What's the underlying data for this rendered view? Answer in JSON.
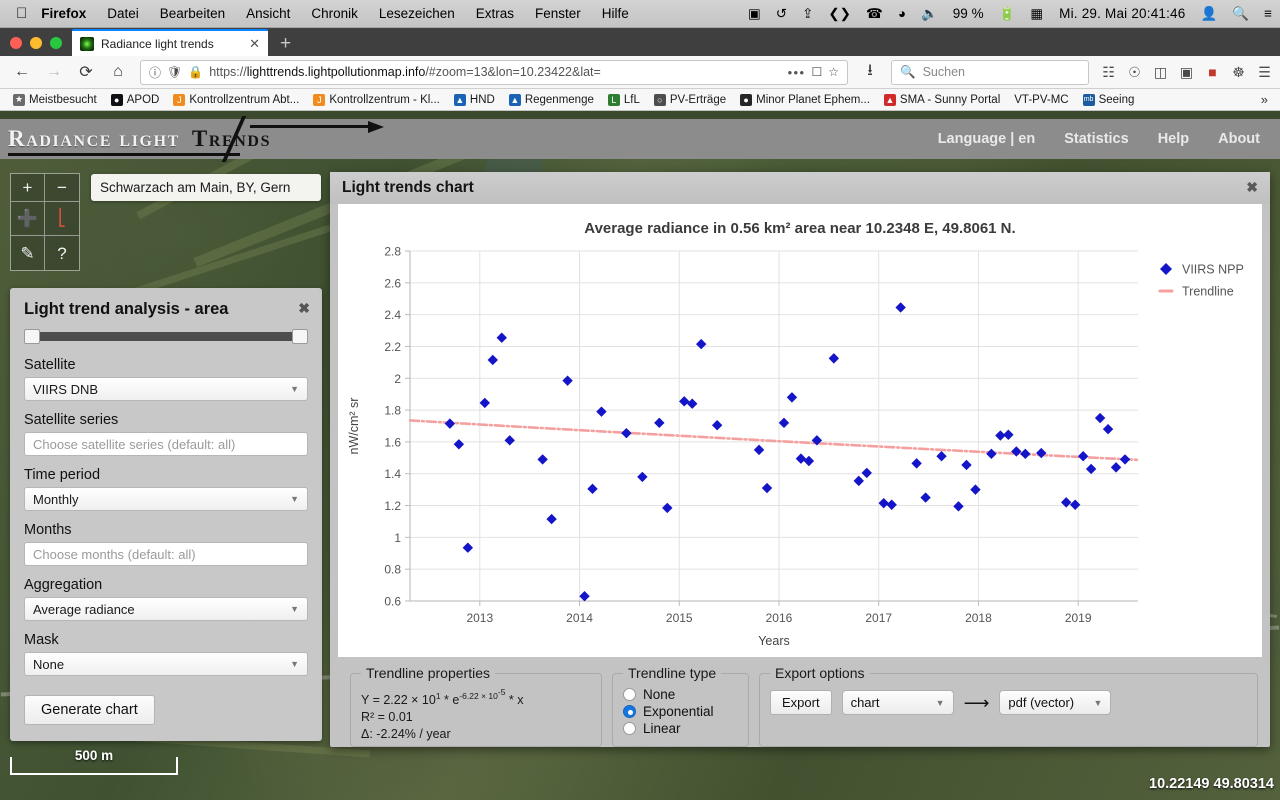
{
  "os_menubar": {
    "apple_icon": "apple-icon",
    "app_name": "Firefox",
    "menus": [
      "Datei",
      "Bearbeiten",
      "Ansicht",
      "Chronik",
      "Lesezeichen",
      "Extras",
      "Fenster",
      "Hilfe"
    ],
    "status_icons": [
      "dropbox-icon",
      "timemachine-icon",
      "bluetooth-icon",
      "code-icon",
      "phone-icon",
      "wifi-icon",
      "volume-icon"
    ],
    "battery_percent": "99 %",
    "battery_icon": "battery-charging-icon",
    "keyboard_icon": "keyboard-input-icon",
    "clock": "Mi. 29. Mai  20:41:46",
    "user_icon": "user-icon",
    "spotlight_icon": "search-icon",
    "notification_icon": "notification-center-icon"
  },
  "browser": {
    "tab": {
      "title": "Radiance light trends",
      "favicon": "globe-nightlights-favicon",
      "close_label": "✕"
    },
    "newtab_label": "+",
    "nav": {
      "back": "←",
      "forward": "→",
      "reload": "⟳",
      "home": "⌂"
    },
    "urlbar": {
      "info_icon": "page-info-icon",
      "shield_icon": "tracking-protection-icon",
      "lock_icon": "lock-icon",
      "url_scheme": "https://",
      "url_host": "lighttrends.lightpollutionmap.info",
      "url_path": "/#zoom=13&lon=10.23422&lat=",
      "overflow_dots": "•••",
      "reader_icon": "reader-mode-icon",
      "bookmark_star": "☆"
    },
    "downloads_icon": "download-icon",
    "search": {
      "icon": "search-icon",
      "placeholder": "Suchen",
      "value": ""
    },
    "chrome_icons": [
      "library-icon",
      "pocket-icon",
      "sidebar-icon",
      "container-icon",
      "adobe-pdf-icon",
      "sync-icon"
    ],
    "menu_icon": "hamburger-menu-icon",
    "bookmarks": [
      {
        "label": "Meistbesucht",
        "icon": "star-folder-icon",
        "color": "#6b6b6b"
      },
      {
        "label": "APOD",
        "icon": "apod-icon",
        "color": "#101014"
      },
      {
        "label": "Kontrollzentrum Abt...",
        "icon": "joomla-icon",
        "color": "#f28b1d"
      },
      {
        "label": "Kontrollzentrum - Kl...",
        "icon": "joomla-icon",
        "color": "#f28b1d"
      },
      {
        "label": "HND",
        "icon": "hnd-icon",
        "color": "#1b63b5"
      },
      {
        "label": "Regenmenge",
        "icon": "rain-icon",
        "color": "#1b63b5"
      },
      {
        "label": "LfL",
        "icon": "lfl-icon",
        "color": "#2f7d32"
      },
      {
        "label": "PV-Erträge",
        "icon": "globe-icon",
        "color": "#4d4d4d"
      },
      {
        "label": "Minor Planet Ephem...",
        "icon": "planet-icon",
        "color": "#262626"
      },
      {
        "label": "SMA - Sunny Portal",
        "icon": "sma-icon",
        "color": "#d02a2a"
      },
      {
        "label": "VT-PV-MC",
        "icon": "blank-page-icon",
        "color": "#00000000"
      },
      {
        "label": "Seeing",
        "icon": "meteoblue-icon",
        "color": "#1d5c9e"
      }
    ],
    "bookmarks_overflow": "»"
  },
  "site": {
    "logo_part1": "Radiance light",
    "logo_part2": "Trends",
    "nav": [
      "Language | en",
      "Statistics",
      "Help",
      "About"
    ]
  },
  "map": {
    "controls": [
      {
        "name": "zoom-in",
        "glyph": "+"
      },
      {
        "name": "zoom-out",
        "glyph": "−"
      },
      {
        "name": "crosshair-select",
        "glyph": "➕"
      },
      {
        "name": "draw-area",
        "glyph": "⟀"
      },
      {
        "name": "measure-ruler",
        "glyph": "✐"
      },
      {
        "name": "help",
        "glyph": "?"
      }
    ],
    "place_label": "Schwarzach am Main, BY, Gern",
    "scale_label": "500 m",
    "coordinates": "10.22149 49.80314"
  },
  "analysis_panel": {
    "title": "Light trend analysis - area",
    "close_label": "✖",
    "fields": [
      {
        "label": "Satellite",
        "type": "select",
        "value": "VIIRS DNB"
      },
      {
        "label": "Satellite series",
        "type": "input",
        "value": "",
        "placeholder": "Choose satellite series (default: all)"
      },
      {
        "label": "Time period",
        "type": "select",
        "value": "Monthly"
      },
      {
        "label": "Months",
        "type": "input",
        "value": "",
        "placeholder": "Choose months (default: all)"
      },
      {
        "label": "Aggregation",
        "type": "select",
        "value": "Average radiance"
      },
      {
        "label": "Mask",
        "type": "select",
        "value": "None"
      }
    ],
    "generate_button": "Generate chart"
  },
  "chart_window": {
    "title": "Light trends chart",
    "close_label": "✖"
  },
  "chart_data": {
    "type": "scatter",
    "title": "Average radiance in 0.56 km² area near 10.2348 E, 49.8061 N.",
    "xlabel": "Years",
    "ylabel": "nW/cm² sr",
    "xlim": [
      2012.3,
      2019.6
    ],
    "ylim": [
      0.6,
      2.8
    ],
    "ytick_step": 0.2,
    "yticks": [
      0.6,
      0.8,
      1.0,
      1.2,
      1.4,
      1.6,
      1.8,
      2.0,
      2.2,
      2.4,
      2.6,
      2.8
    ],
    "ytick_labels": [
      "0.6",
      "0.8",
      "1",
      "1.2",
      "1.4",
      "1.6",
      "1.8",
      "2",
      "2.2",
      "2.4",
      "2.6",
      "2.8"
    ],
    "xticks": [
      2013,
      2014,
      2015,
      2016,
      2017,
      2018,
      2019
    ],
    "xtick_labels": [
      "2013",
      "2014",
      "2015",
      "2016",
      "2017",
      "2018",
      "2019"
    ],
    "grid": true,
    "legend_position": "right",
    "legend": [
      {
        "label": "VIIRS NPP",
        "marker": "diamond",
        "color": "#1414c8"
      },
      {
        "label": "Trendline",
        "marker": "line-dashed",
        "color": "#f4a0a0"
      }
    ],
    "series": [
      {
        "name": "VIIRS NPP",
        "color": "#1414c8",
        "marker": "diamond",
        "points": [
          [
            2012.7,
            1.715
          ],
          [
            2012.79,
            1.585
          ],
          [
            2012.88,
            0.935
          ],
          [
            2013.05,
            1.845
          ],
          [
            2013.13,
            2.115
          ],
          [
            2013.22,
            2.255
          ],
          [
            2013.3,
            1.61
          ],
          [
            2013.63,
            1.49
          ],
          [
            2013.72,
            1.115
          ],
          [
            2013.88,
            1.985
          ],
          [
            2014.05,
            0.63
          ],
          [
            2014.13,
            1.305
          ],
          [
            2014.22,
            1.79
          ],
          [
            2014.47,
            1.655
          ],
          [
            2014.63,
            1.38
          ],
          [
            2014.8,
            1.72
          ],
          [
            2014.88,
            1.185
          ],
          [
            2015.05,
            1.855
          ],
          [
            2015.13,
            1.84
          ],
          [
            2015.22,
            2.215
          ],
          [
            2015.38,
            1.705
          ],
          [
            2015.8,
            1.55
          ],
          [
            2015.88,
            1.31
          ],
          [
            2016.05,
            1.72
          ],
          [
            2016.13,
            1.88
          ],
          [
            2016.22,
            1.495
          ],
          [
            2016.3,
            1.48
          ],
          [
            2016.38,
            1.61
          ],
          [
            2016.55,
            2.125
          ],
          [
            2016.8,
            1.355
          ],
          [
            2016.88,
            1.405
          ],
          [
            2017.05,
            1.215
          ],
          [
            2017.13,
            1.205
          ],
          [
            2017.22,
            2.445
          ],
          [
            2017.38,
            1.465
          ],
          [
            2017.47,
            1.25
          ],
          [
            2017.63,
            1.51
          ],
          [
            2017.8,
            1.195
          ],
          [
            2017.88,
            1.455
          ],
          [
            2017.97,
            1.3
          ],
          [
            2018.13,
            1.525
          ],
          [
            2018.22,
            1.64
          ],
          [
            2018.3,
            1.645
          ],
          [
            2018.38,
            1.54
          ],
          [
            2018.47,
            1.525
          ],
          [
            2018.63,
            1.53
          ],
          [
            2018.88,
            1.22
          ],
          [
            2018.97,
            1.205
          ],
          [
            2019.05,
            1.51
          ],
          [
            2019.13,
            1.43
          ],
          [
            2019.22,
            1.75
          ],
          [
            2019.3,
            1.68
          ],
          [
            2019.38,
            1.44
          ],
          [
            2019.47,
            1.49
          ]
        ]
      }
    ],
    "trendline": {
      "name": "Trendline",
      "color": "#f4a0a0",
      "style": "dash-dot",
      "type": "exponential",
      "start": [
        2012.3,
        1.735
      ],
      "end": [
        2019.6,
        1.487
      ]
    }
  },
  "trendline_properties": {
    "legend": "Trendline properties",
    "equation_prefix": "Y = 2.22 × 10",
    "equation_exp1": "1",
    "equation_mid": " * e",
    "equation_exp2": "-6.22 × 10",
    "equation_exp3": "-5",
    "equation_suffix": " * x",
    "r2": "R² = 0.01",
    "delta": "Δ: -2.24% / year"
  },
  "trendline_type": {
    "legend": "Trendline type",
    "options": [
      {
        "label": "None",
        "selected": false
      },
      {
        "label": "Exponential",
        "selected": true
      },
      {
        "label": "Linear",
        "selected": false
      }
    ]
  },
  "export_options": {
    "legend": "Export options",
    "button": "Export",
    "what": "chart",
    "arrow": "⟶",
    "format": "pdf (vector)"
  }
}
